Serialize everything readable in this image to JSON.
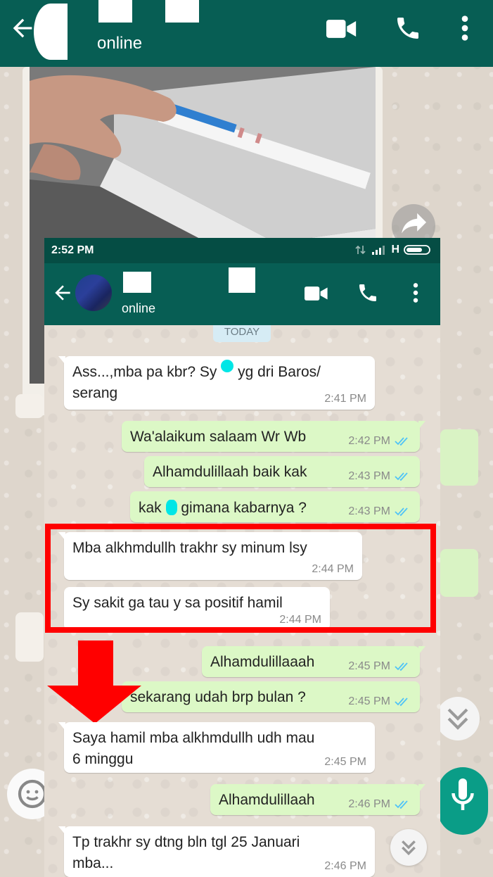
{
  "outer": {
    "status": "online"
  },
  "inner": {
    "statusbar": {
      "time": "2:52 PM",
      "network": "H"
    },
    "header": {
      "status": "online"
    },
    "date_chip": "TODAY",
    "messages": [
      {
        "direction": "in",
        "lines": [
          "Ass...,mba pa kbr? Sy",
          "yg dri Baros/",
          "serang"
        ],
        "time": "2:41 PM"
      },
      {
        "direction": "out",
        "lines": [
          "Wa'alaikum salaam Wr Wb"
        ],
        "time": "2:42 PM"
      },
      {
        "direction": "out",
        "lines": [
          "Alhamdulillaah baik kak"
        ],
        "time": "2:43 PM"
      },
      {
        "direction": "out",
        "lines": [
          "kak",
          "gimana kabarnya ?"
        ],
        "time": "2:43 PM"
      },
      {
        "direction": "in",
        "lines": [
          "Mba alkhmdullh trakhr sy minum lsy"
        ],
        "time": "2:44 PM"
      },
      {
        "direction": "in",
        "lines": [
          "Sy sakit ga tau y sa positif hamil"
        ],
        "time": "2:44 PM"
      },
      {
        "direction": "out",
        "lines": [
          "Alhamdulillaaah"
        ],
        "time": "2:45 PM"
      },
      {
        "direction": "out",
        "lines": [
          "sekarang udah brp bulan ?"
        ],
        "time": "2:45 PM"
      },
      {
        "direction": "in",
        "lines": [
          "Saya hamil mba alkhmdullh udh mau",
          "6 minggu"
        ],
        "time": "2:45 PM"
      },
      {
        "direction": "out",
        "lines": [
          "Alhamdulillaah"
        ],
        "time": "2:46 PM"
      },
      {
        "direction": "in",
        "lines": [
          "Tp trakhr sy dtng bln tgl 25 Januari",
          "mba..."
        ],
        "time": "2:46 PM"
      }
    ]
  },
  "colors": {
    "header": "#075e54",
    "statusbar": "#054d44",
    "outgoing_bubble": "#dcf8c6",
    "incoming_bubble": "#ffffff",
    "read_ticks": "#4fc3f7",
    "highlight": "#ff0000",
    "annotation_arrow": "#ff0000",
    "mic_button": "#0a9d87"
  },
  "icons": {
    "back": "back-arrow-icon",
    "video": "video-call-icon",
    "call": "phone-icon",
    "menu": "more-vert-icon",
    "read": "double-check-icon",
    "forward": "forward-icon",
    "scroll": "double-chevron-down-icon",
    "mic": "mic-icon",
    "emoji": "emoji-icon"
  }
}
